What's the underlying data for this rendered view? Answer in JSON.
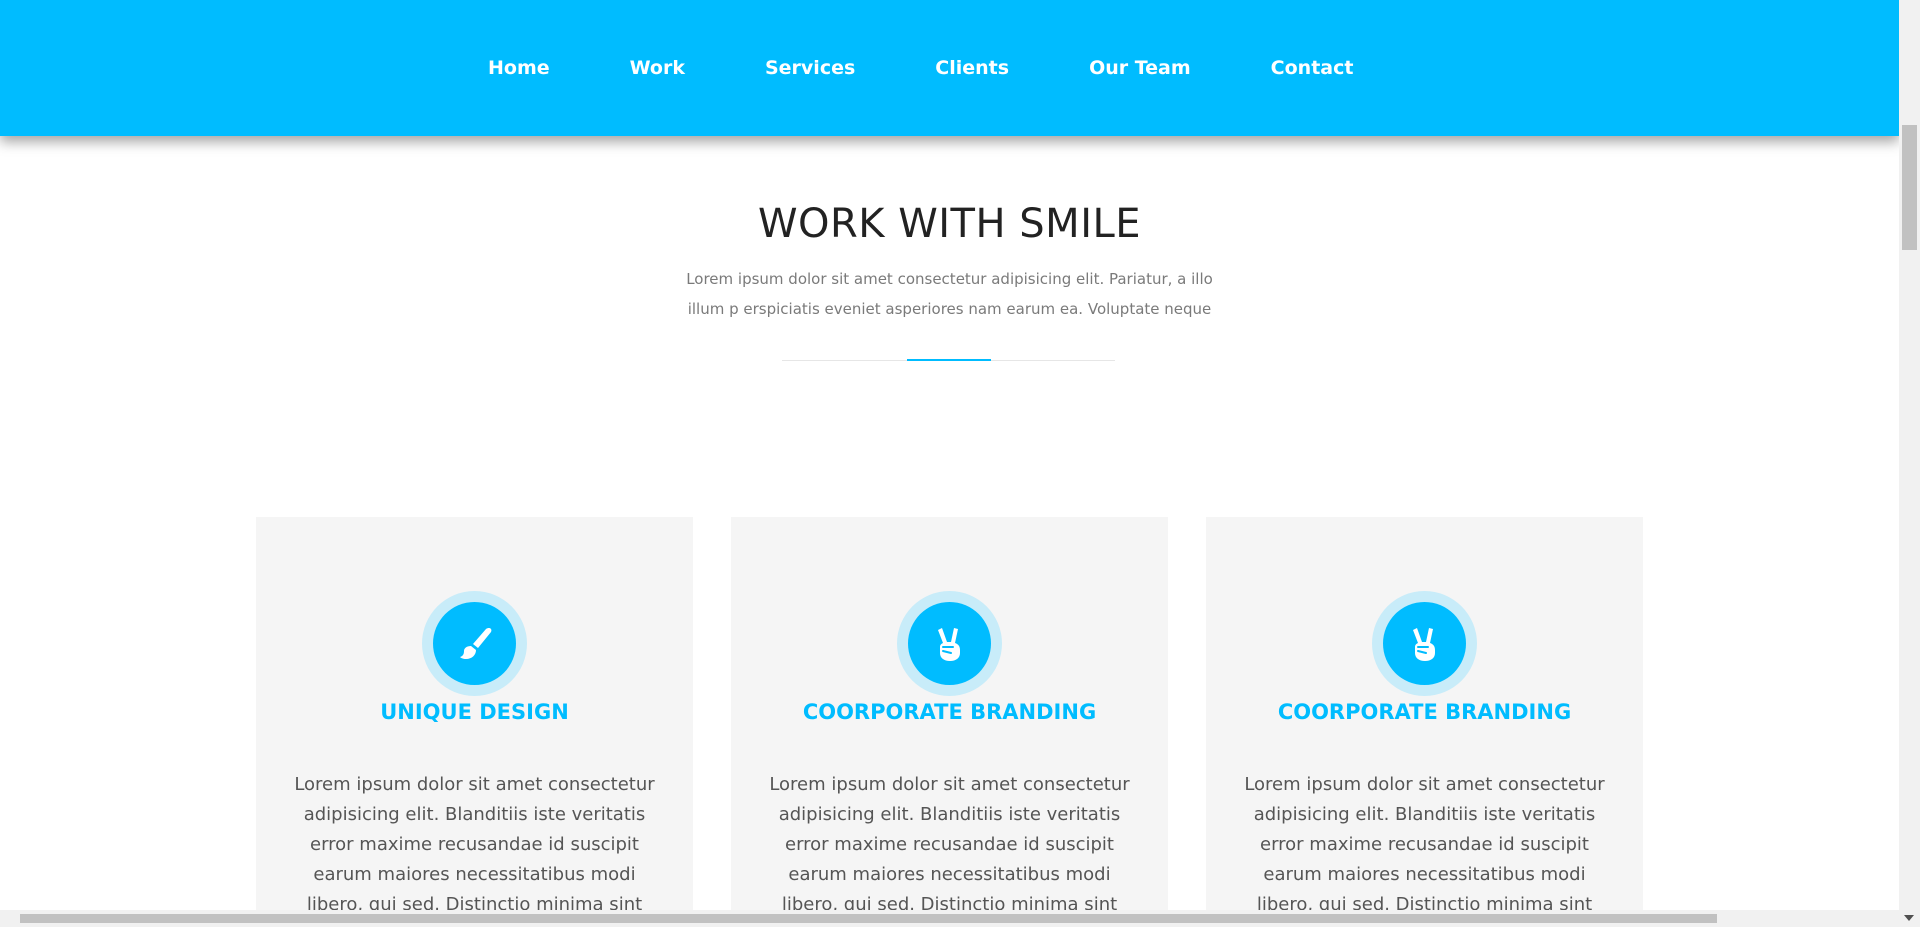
{
  "nav": {
    "items": [
      {
        "label": "Home"
      },
      {
        "label": "Work"
      },
      {
        "label": "Services"
      },
      {
        "label": "Clients"
      },
      {
        "label": "Our Team"
      },
      {
        "label": "Contact"
      }
    ],
    "background_color": "#00bcff"
  },
  "section": {
    "title": "WORK WITH SMILE",
    "subtitle": "Lorem ipsum dolor sit amet consectetur adipisicing elit. Pariatur, a illo illum p erspiciatis eveniet asperiores nam earum ea. Voluptate neque",
    "accent_color": "#00bcff"
  },
  "cards": [
    {
      "icon": "paintbrush-icon",
      "title": "UNIQUE DESIGN",
      "text": "Lorem ipsum dolor sit amet consectetur adipisicing elit. Blanditiis iste veritatis error maxime recusandae id suscipit earum maiores necessitatibus modi libero, qui sed. Distinctio minima sint error illum"
    },
    {
      "icon": "peace-hand-icon",
      "title": "COORPORATE BRANDING",
      "text": "Lorem ipsum dolor sit amet consectetur adipisicing elit. Blanditiis iste veritatis error maxime recusandae id suscipit earum maiores necessitatibus modi libero, qui sed. Distinctio minima sint error illum"
    },
    {
      "icon": "peace-hand-icon",
      "title": "COORPORATE BRANDING",
      "text": "Lorem ipsum dolor sit amet consectetur adipisicing elit. Blanditiis iste veritatis error maxime recusandae id suscipit earum maiores necessitatibus modi libero, qui sed. Distinctio minima sint error illum"
    }
  ]
}
